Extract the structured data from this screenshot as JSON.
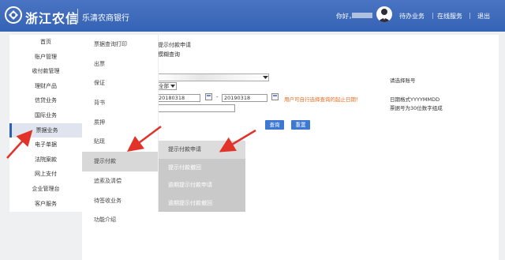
{
  "header": {
    "brand": "浙江农信",
    "bank": "乐清农商银行",
    "greeting": "你好，",
    "nav": [
      "待办业务",
      "在线服务",
      "退出"
    ]
  },
  "sidebar": {
    "items": [
      "首页",
      "账户管理",
      "收付款管理",
      "理财产品",
      "信贷业务",
      "国际业务",
      "票据业务",
      "电子单据",
      "法院案款",
      "网上支付",
      "企业管理台",
      "客户服务"
    ],
    "active_index": 6
  },
  "menu": {
    "col1": [
      "票据查询打印",
      "出票",
      "保证",
      "背书",
      "质押",
      "贴现",
      "提示付款",
      "追索及清偿",
      "待签收业务",
      "功能介绍"
    ],
    "col1_active_index": 6,
    "col2": [
      "提示付款申请",
      "提示付款撤回",
      "逾期提示付款申请",
      "逾期提示付款撤回"
    ],
    "col2_active_index": 0
  },
  "form": {
    "title": "提示付款申请",
    "subtitle": "模糊查询",
    "select_all": "全部",
    "date_from": "20180318",
    "date_to": "20190318",
    "dash": "-",
    "hint": "用户可自行选择查询的起止日期！",
    "label_account": "请选择账号",
    "label_date_format": "日期格式YYYYMMDD",
    "label_bill_no": "票据号为30位数字组成",
    "btn_query": "查询",
    "btn_reset": "重置"
  },
  "colors": {
    "header_blue": "#3563b5",
    "accent_button": "#3d78d1",
    "hint_orange": "#f06a1e",
    "arrow_red": "#e2332a"
  }
}
